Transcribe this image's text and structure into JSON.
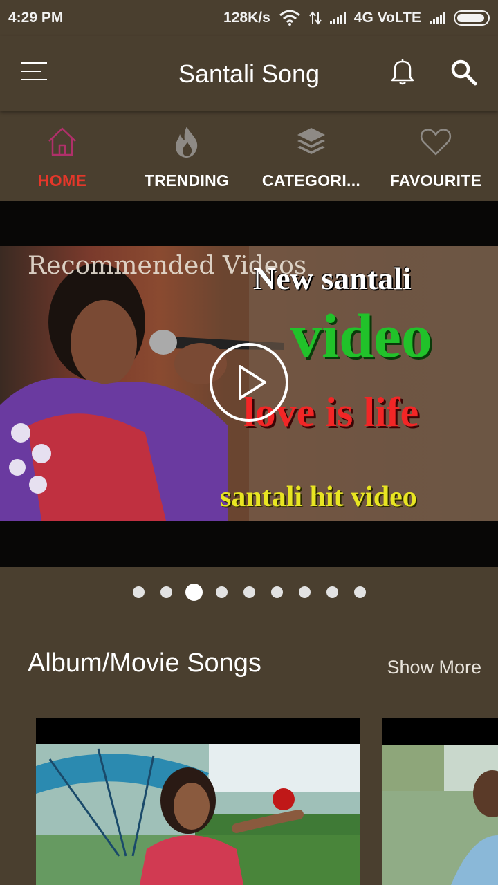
{
  "status_bar": {
    "time": "4:29 PM",
    "speed": "128K/s",
    "network": "4G VoLTE"
  },
  "toolbar": {
    "title": "Santali Song",
    "menu_icon": "hamburger-menu-icon",
    "bell_icon": "bell-icon",
    "search_icon": "search-icon"
  },
  "tabs": [
    {
      "label": "HOME",
      "icon": "home-icon",
      "active": true
    },
    {
      "label": "TRENDING",
      "icon": "flame-icon",
      "active": false
    },
    {
      "label": "CATEGORI...",
      "icon": "layers-icon",
      "active": false
    },
    {
      "label": "FAVOURITE",
      "icon": "heart-icon",
      "active": false
    }
  ],
  "banner": {
    "caption": "Recommended Videos",
    "overlay_lines": [
      "New santali",
      "video",
      "love is life",
      "santali hit video"
    ],
    "slide_count": 9,
    "active_slide": 3
  },
  "section": {
    "title": "Album/Movie Songs",
    "show_more": "Show More"
  },
  "colors": {
    "background": "#4a3f2f",
    "active_tab_label": "#e4372a",
    "active_tab_icon": "#b0306a",
    "inactive_icon": "#8e8a85"
  }
}
